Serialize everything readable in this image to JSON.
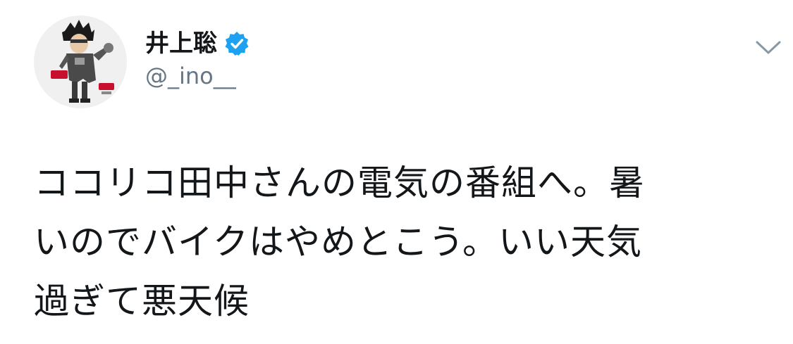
{
  "tweet": {
    "author": {
      "display_name": "井上聡",
      "handle": "@_ino__",
      "verified": true,
      "avatar_icon": "avatar-icon"
    },
    "text_lines": [
      "ココリコ田中さんの電気の番組へ。暑",
      "いのでバイクはやめとこう。いい天気",
      "過ぎて悪天候"
    ],
    "menu_icon": "chevron-down-icon"
  },
  "colors": {
    "text_primary": "#14171a",
    "text_secondary": "#657786",
    "verified_blue": "#1da1f2",
    "caret_gray": "#8899a6"
  }
}
